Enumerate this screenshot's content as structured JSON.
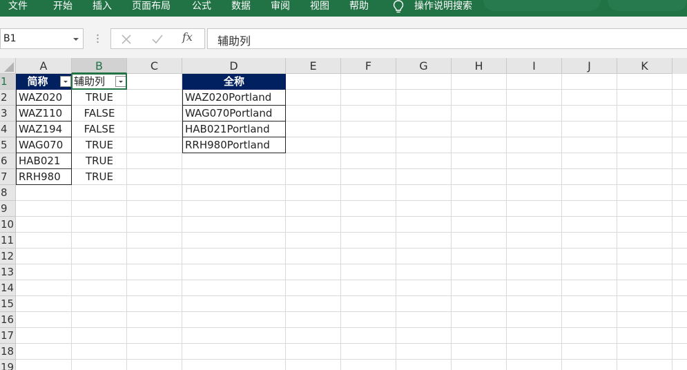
{
  "ribbon": {
    "menu": [
      "文件",
      "开始",
      "插入",
      "页面布局",
      "公式",
      "数据",
      "审阅",
      "视图",
      "帮助"
    ],
    "tell_me": "操作说明搜索",
    "color": "#217346"
  },
  "formula_bar": {
    "name_box": "B1",
    "cancel_icon": "close-icon",
    "enter_icon": "check-icon",
    "function_icon": "fx",
    "content": "辅助列"
  },
  "columns": [
    "A",
    "B",
    "C",
    "D",
    "E",
    "F",
    "G",
    "H",
    "I",
    "J",
    "K"
  ],
  "rows": [
    "1",
    "2",
    "3",
    "4",
    "5",
    "6",
    "7",
    "8",
    "9",
    "10",
    "11",
    "12",
    "13",
    "14",
    "15",
    "16",
    "17",
    "18",
    "19"
  ],
  "table_ab": {
    "header_a": "简称",
    "header_b": "辅助列",
    "header_color": "#002060",
    "rows": [
      {
        "a": "WAZ020",
        "b": "TRUE"
      },
      {
        "a": "WAZ110",
        "b": "FALSE"
      },
      {
        "a": "WAZ194",
        "b": "FALSE"
      },
      {
        "a": "WAG070",
        "b": "TRUE"
      },
      {
        "a": "HAB021",
        "b": "TRUE"
      },
      {
        "a": "RRH980",
        "b": "TRUE"
      }
    ]
  },
  "table_d": {
    "header": "全称",
    "rows": [
      "WAZ020Portland",
      "WAG070Portland",
      "HAB021Portland",
      "RRH980Portland"
    ]
  },
  "selection": {
    "cell": "B1"
  }
}
